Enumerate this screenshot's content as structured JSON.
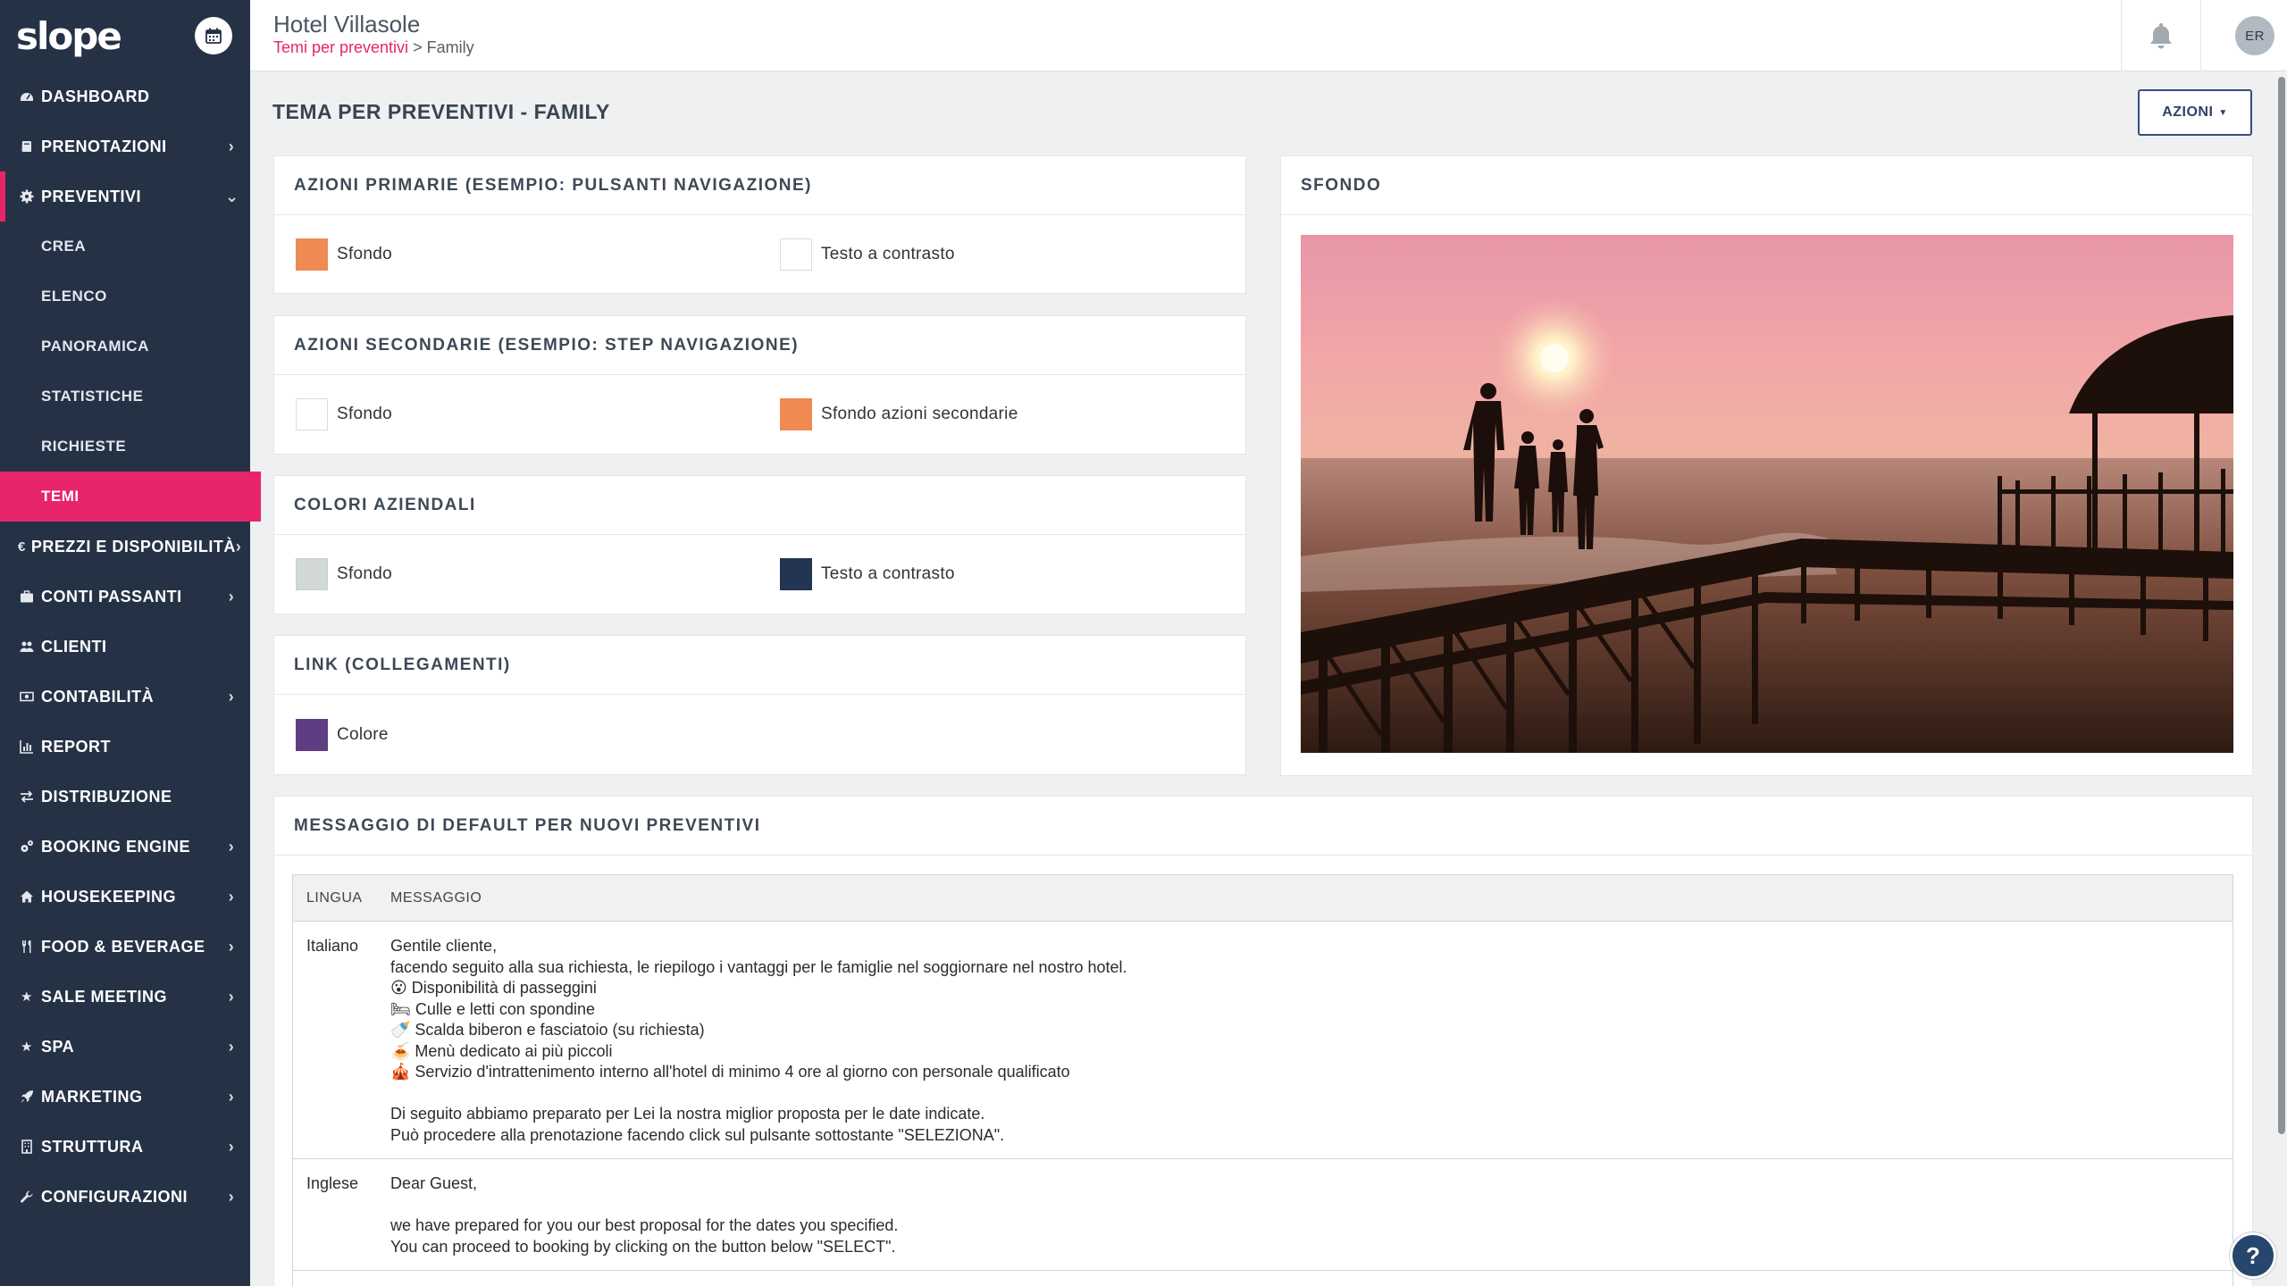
{
  "sidebar": {
    "logo": "slope",
    "items": [
      {
        "label": "DASHBOARD",
        "icon": "dashboard-icon",
        "chev": ""
      },
      {
        "label": "PRENOTAZIONI",
        "icon": "book-icon",
        "chev": "›"
      },
      {
        "label": "PREVENTIVI",
        "icon": "gear-icon",
        "chev": "⌄"
      },
      {
        "label": "PREZZI E DISPONIBILITÀ",
        "icon": "euro-icon",
        "chev": "›"
      },
      {
        "label": "CONTI PASSANTI",
        "icon": "briefcase-icon",
        "chev": "›"
      },
      {
        "label": "CLIENTI",
        "icon": "users-icon",
        "chev": ""
      },
      {
        "label": "CONTABILITÀ",
        "icon": "money-icon",
        "chev": "›"
      },
      {
        "label": "REPORT",
        "icon": "bar-chart-icon",
        "chev": ""
      },
      {
        "label": "DISTRIBUZIONE",
        "icon": "exchange-icon",
        "chev": ""
      },
      {
        "label": "BOOKING ENGINE",
        "icon": "cogs-icon",
        "chev": "›"
      },
      {
        "label": "HOUSEKEEPING",
        "icon": "home-icon",
        "chev": "›"
      },
      {
        "label": "FOOD & BEVERAGE",
        "icon": "cutlery-icon",
        "chev": "›"
      },
      {
        "label": "SALE MEETING",
        "icon": "star-icon",
        "chev": "›"
      },
      {
        "label": "SPA",
        "icon": "star-icon",
        "chev": "›"
      },
      {
        "label": "MARKETING",
        "icon": "rocket-icon",
        "chev": "›"
      },
      {
        "label": "STRUTTURA",
        "icon": "building-icon",
        "chev": "›"
      },
      {
        "label": "CONFIGURAZIONI",
        "icon": "wrench-icon",
        "chev": "›"
      }
    ],
    "sub_items": [
      "CREA",
      "ELENCO",
      "PANORAMICA",
      "STATISTICHE",
      "RICHIESTE",
      "TEMI"
    ]
  },
  "topbar": {
    "hotel": "Hotel Villasole",
    "breadcrumb_link": "Temi per preventivi",
    "breadcrumb_sep": " > ",
    "breadcrumb_current": "Family",
    "avatar": "ER"
  },
  "page": {
    "title": "TEMA PER PREVENTIVI - FAMILY",
    "actions_label": "AZIONI"
  },
  "cards": {
    "primarie": {
      "title": "AZIONI PRIMARIE (ESEMPIO: PULSANTI NAVIGAZIONE)",
      "sw1": "Sfondo",
      "sw1_color": "#ef8a52",
      "sw2": "Testo a contrasto",
      "sw2_color": "#ffffff"
    },
    "secondarie": {
      "title": "AZIONI SECONDARIE (ESEMPIO: STEP NAVIGAZIONE)",
      "sw1": "Sfondo",
      "sw1_color": "#ffffff",
      "sw2": "Sfondo azioni secondarie",
      "sw2_color": "#ef8a52"
    },
    "aziendali": {
      "title": "COLORI AZIENDALI",
      "sw1": "Sfondo",
      "sw1_color": "#d2d8d8",
      "sw2": "Testo a contrasto",
      "sw2_color": "#243553"
    },
    "link": {
      "title": "LINK (COLLEGAMENTI)",
      "sw1": "Colore",
      "sw1_color": "#5e3d82"
    },
    "sfondo": {
      "title": "SFONDO"
    },
    "messaggio": {
      "title": "MESSAGGIO DI DEFAULT PER NUOVI PREVENTIVI"
    }
  },
  "table": {
    "headers": [
      "LINGUA",
      "MESSAGGIO"
    ],
    "rows": [
      {
        "lang": "Italiano",
        "lines": [
          "Gentile cliente,",
          "facendo seguito alla sua richiesta, le riepilogo i vantaggi per le famiglie nel soggiornare nel nostro hotel.",
          "😮 Disponibilità di passeggini",
          "🛏 Culle e letti con spondine",
          "🍼 Scalda biberon e fasciatoio (su richiesta)",
          "🍝 Menù dedicato ai più piccoli",
          "🎪 Servizio d'intrattenimento interno all'hotel di minimo 4 ore al giorno con personale qualificato",
          "",
          "Di seguito abbiamo preparato per Lei la nostra miglior proposta per le date indicate.",
          "Può procedere alla prenotazione facendo click sul pulsante sottostante \"SELEZIONA\"."
        ]
      },
      {
        "lang": "Inglese",
        "lines": [
          "Dear Guest,",
          "",
          "we have prepared for you our best proposal for the dates you specified.",
          "You can proceed to booking by clicking on the button below \"SELECT\"."
        ]
      }
    ]
  },
  "colors": {
    "accent": "#e8256b",
    "sidebar": "#253246",
    "primary_button": "#2f4266"
  }
}
